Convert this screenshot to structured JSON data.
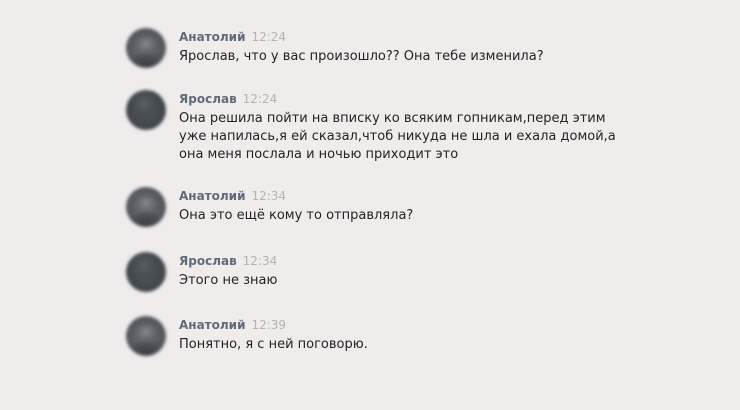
{
  "messages": [
    {
      "author": "Анатолий",
      "time": "12:24",
      "text": "Ярослав, что у вас произошло?? Она тебе изменила?",
      "avatar": "anatoly"
    },
    {
      "author": "Ярослав",
      "time": "12:24",
      "text": "Она решила пойти на вписку ко всяким гопникам,перед этим\nуже напилась,я ей сказал,чтоб никуда не шла и ехала домой,а\nона меня послала и ночью приходит это",
      "avatar": "yaroslav"
    },
    {
      "author": "Анатолий",
      "time": "12:34",
      "text": "Она это ещё кому то отправляла?",
      "avatar": "anatoly"
    },
    {
      "author": "Ярослав",
      "time": "12:34",
      "text": "Этого не знаю",
      "avatar": "yaroslav"
    },
    {
      "author": "Анатолий",
      "time": "12:39",
      "text": "Понятно, я с ней поговорю.",
      "avatar": "anatoly"
    }
  ]
}
